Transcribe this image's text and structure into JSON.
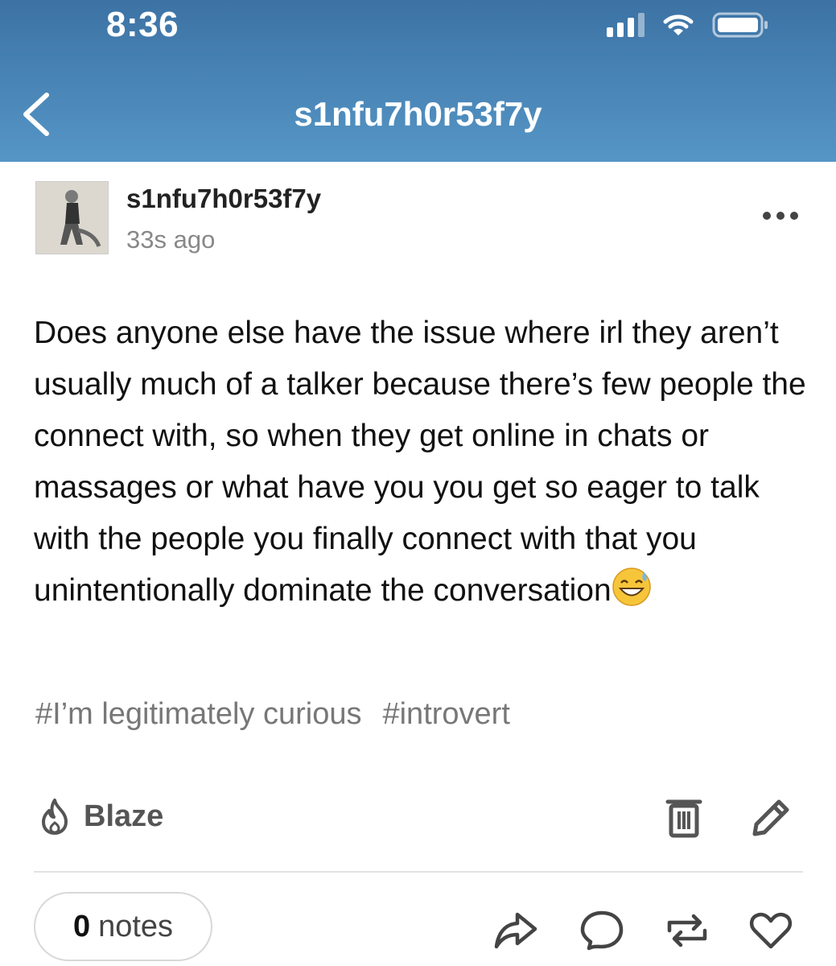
{
  "status_bar": {
    "time": "8:36",
    "icons": [
      "signal-icon",
      "wifi-icon",
      "battery-icon"
    ]
  },
  "header": {
    "title": "s1nfu7h0r53f7y",
    "back_icon": "chevron-left-icon",
    "background": "#4a86b8"
  },
  "post": {
    "author": "s1nfu7h0r53f7y",
    "timestamp": "33s ago",
    "body": "Does anyone else have the issue where irl they aren’t usually much of a talker because there’s few people the connect with, so when they get online in chats or massages or what have you you get so eager to talk with the people you finally connect with that you unintentionally dominate the conversation",
    "emoji": "😅",
    "tags": [
      "#I’m legitimately curious",
      "#introvert"
    ]
  },
  "toolbar": {
    "blaze_label": "Blaze",
    "icons": [
      "flame-icon",
      "trash-icon",
      "pencil-icon"
    ]
  },
  "footer": {
    "notes_count": "0",
    "notes_label": "notes",
    "icons": [
      "share-icon",
      "comment-icon",
      "reblog-icon",
      "heart-icon"
    ]
  }
}
